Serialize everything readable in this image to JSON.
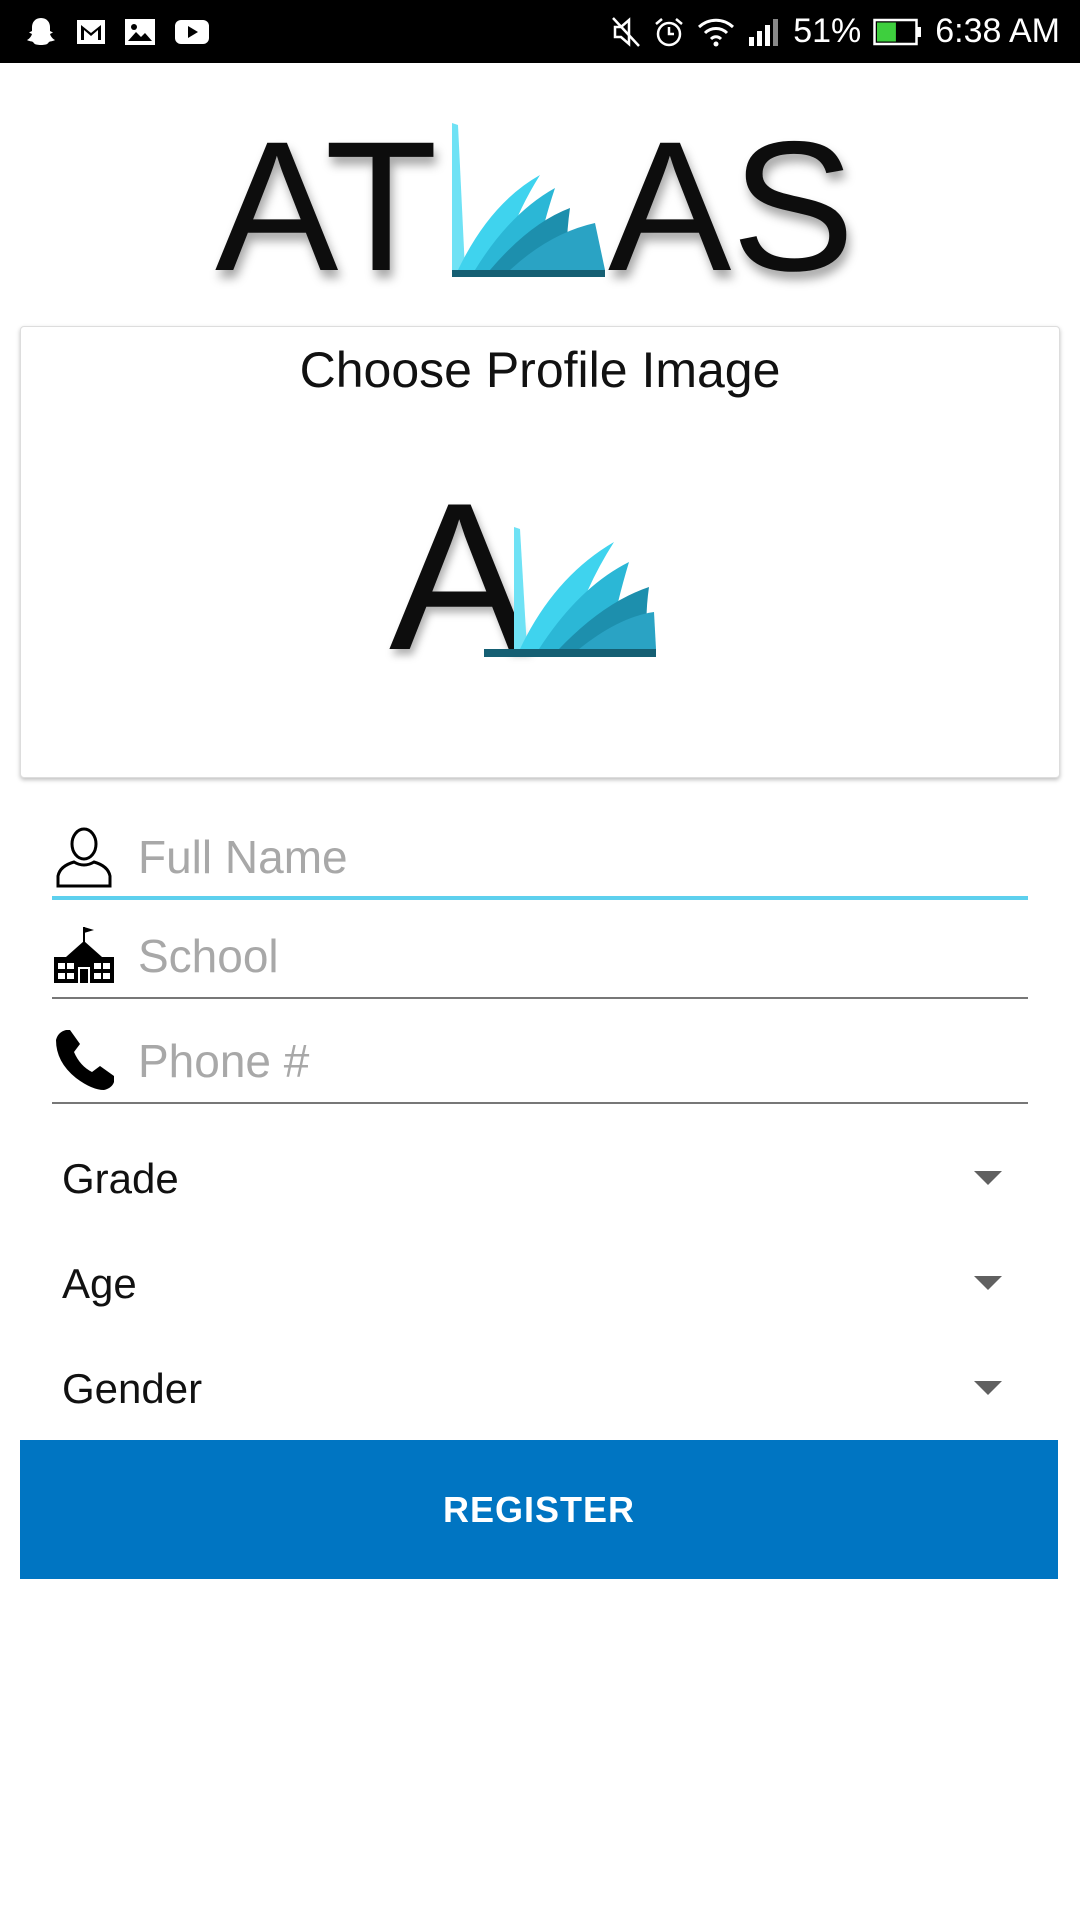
{
  "status_bar": {
    "notification_icons": [
      "snapchat-icon",
      "gmail-icon",
      "gallery-icon",
      "youtube-icon"
    ],
    "system_icons": [
      "mute-icon",
      "alarm-icon",
      "wifi-icon",
      "signal-icon",
      "battery-icon"
    ],
    "battery_percent": "51%",
    "battery_level": 0.51,
    "time": "6:38 AM"
  },
  "logo": {
    "text_left": "AT",
    "text_right": "AS",
    "book_color": "#3fd3ee"
  },
  "profile": {
    "title": "Choose Profile Image",
    "image_letter": "A"
  },
  "form": {
    "full_name": {
      "value": "",
      "placeholder": "Full Name",
      "icon": "person-icon"
    },
    "school": {
      "value": "",
      "placeholder": "School",
      "icon": "school-icon"
    },
    "phone": {
      "value": "",
      "placeholder": "Phone #",
      "icon": "phone-icon"
    },
    "grade": {
      "label": "Grade"
    },
    "age": {
      "label": "Age"
    },
    "gender": {
      "label": "Gender"
    },
    "register_label": "REGISTER"
  },
  "colors": {
    "accent_underline": "#5dd0ee",
    "register_button": "#0075c2",
    "placeholder": "#a8a8a8"
  }
}
